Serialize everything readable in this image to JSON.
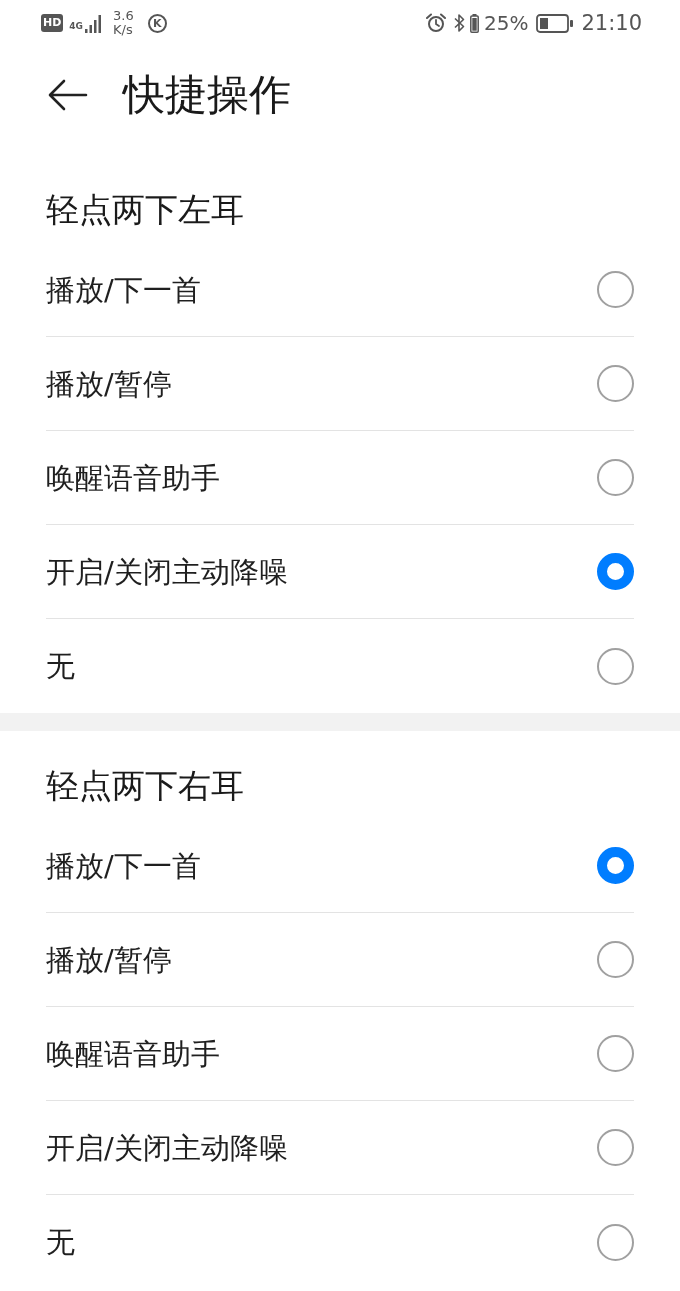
{
  "status_bar": {
    "hd_badge": "HD",
    "network_type": "4G",
    "speed_value": "3.6",
    "speed_unit": "K/s",
    "app_badge": "K",
    "battery_percent": "25%",
    "time": "21:10"
  },
  "header": {
    "title": "快捷操作"
  },
  "sections": [
    {
      "heading": "轻点两下左耳",
      "options": [
        {
          "label": "播放/下一首",
          "selected": false
        },
        {
          "label": "播放/暂停",
          "selected": false
        },
        {
          "label": "唤醒语音助手",
          "selected": false
        },
        {
          "label": "开启/关闭主动降噪",
          "selected": true
        },
        {
          "label": "无",
          "selected": false
        }
      ]
    },
    {
      "heading": "轻点两下右耳",
      "options": [
        {
          "label": "播放/下一首",
          "selected": true
        },
        {
          "label": "播放/暂停",
          "selected": false
        },
        {
          "label": "唤醒语音助手",
          "selected": false
        },
        {
          "label": "开启/关闭主动降噪",
          "selected": false
        },
        {
          "label": "无",
          "selected": false
        }
      ]
    }
  ]
}
